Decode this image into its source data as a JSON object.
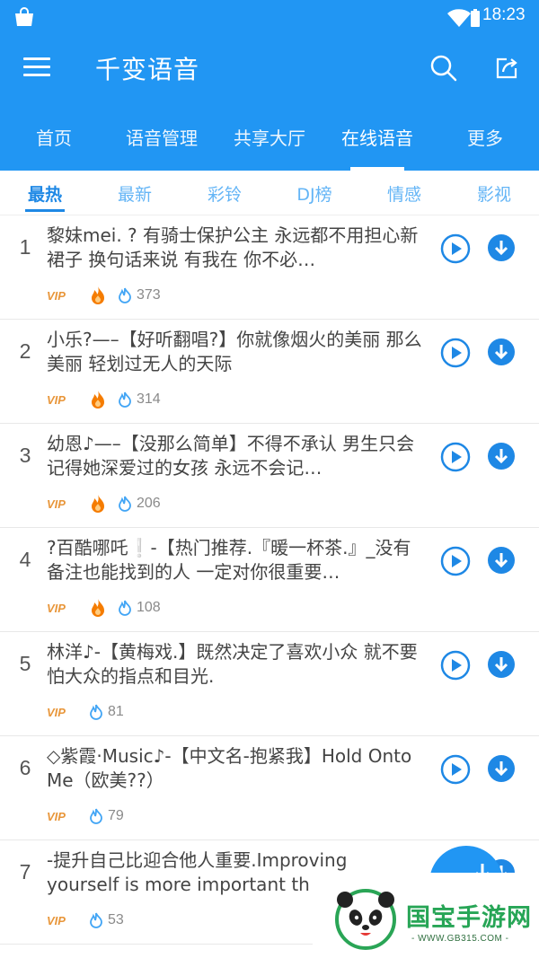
{
  "status_bar": {
    "time": "18:23"
  },
  "app_bar": {
    "title": "千变语音"
  },
  "main_tabs": [
    {
      "label": "首页",
      "active": false
    },
    {
      "label": "语音管理",
      "active": false
    },
    {
      "label": "共享大厅",
      "active": false
    },
    {
      "label": "在线语音",
      "active": true
    },
    {
      "label": "更多",
      "active": false
    }
  ],
  "sub_tabs": [
    {
      "label": "最热",
      "active": true
    },
    {
      "label": "最新",
      "active": false
    },
    {
      "label": "彩铃",
      "active": false
    },
    {
      "label": "DJ榜",
      "active": false
    },
    {
      "label": "情感",
      "active": false
    },
    {
      "label": "影视",
      "active": false
    }
  ],
  "items": [
    {
      "rank": "1",
      "text": "黎妹mei. ? 有骑士保护公主 永远都不用担心新裙子 换句话来说 有我在 你不必…",
      "vip": "VIP",
      "hot": true,
      "count": "373"
    },
    {
      "rank": "2",
      "text": "小乐?—–【好听翻唱?】你就像烟火的美丽 那么美丽 轻划过无人的天际",
      "vip": "VIP",
      "hot": true,
      "count": "314"
    },
    {
      "rank": "3",
      "text": "幼恩♪—–【没那么简单】不得不承认 男生只会记得她深爱过的女孩 永远不会记…",
      "vip": "VIP",
      "hot": true,
      "count": "206"
    },
    {
      "rank": "4",
      "text": "?百酷哪吒❕-【热门推荐.『暖一杯茶.』_没有备注也能找到的人 一定对你很重要…",
      "vip": "VIP",
      "hot": true,
      "count": "108"
    },
    {
      "rank": "5",
      "text": "林洋♪-【黄梅戏.】既然决定了喜欢小众 就不要怕大众的指点和目光.",
      "vip": "VIP",
      "hot": false,
      "count": "81"
    },
    {
      "rank": "6",
      "text": "◇紫霞·Music♪-【中文名-抱紧我】Hold Onto Me（欧美??）",
      "vip": "VIP",
      "hot": false,
      "count": "79"
    },
    {
      "rank": "7",
      "text": "-提升自己比迎合他人重要.Improving yourself is more important th",
      "vip": "VIP",
      "hot": false,
      "count": "53"
    }
  ],
  "watermark": {
    "brand": "国宝手游网",
    "site": "- WWW.GB315.COM -"
  },
  "colors": {
    "primary": "#2196f3",
    "accent_text": "#1e88e5",
    "vip": "#e8963a",
    "hot": "#f57c00"
  }
}
